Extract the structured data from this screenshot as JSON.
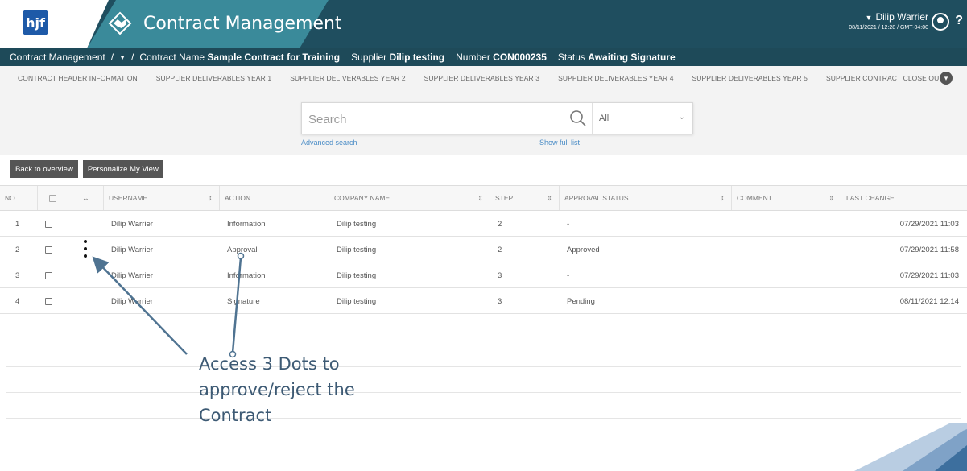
{
  "header": {
    "logo_text": "hjf",
    "app_title": "Contract Management",
    "user_name": "Dilip Warrier",
    "user_caret": "▼",
    "timestamp": "08/11/2021 / 12:28 / GMT-04:00",
    "help_label": "?"
  },
  "breadcrumb": {
    "root": "Contract Management",
    "separator": "/",
    "dropdown_icon": "▼",
    "contract_name_label": "Contract Name",
    "contract_name_value": "Sample Contract for Training",
    "supplier_label": "Supplier",
    "supplier_value": "Dilip testing",
    "number_label": "Number",
    "number_value": "CON000235",
    "status_label": "Status",
    "status_value": "Awaiting Signature"
  },
  "tabs": [
    "CONTRACT HEADER INFORMATION",
    "SUPPLIER DELIVERABLES YEAR 1",
    "SUPPLIER DELIVERABLES YEAR 2",
    "SUPPLIER DELIVERABLES YEAR 3",
    "SUPPLIER DELIVERABLES YEAR 4",
    "SUPPLIER DELIVERABLES YEAR 5",
    "SUPPLIER CONTRACT CLOSE OUT"
  ],
  "search": {
    "placeholder": "Search",
    "scope_value": "All",
    "advanced_link": "Advanced search",
    "full_list_link": "Show full list"
  },
  "buttons": {
    "back": "Back to overview",
    "personalize": "Personalize My View"
  },
  "table": {
    "columns": {
      "no": "NO.",
      "username": "USERNAME",
      "action": "ACTION",
      "company": "COMPANY NAME",
      "step": "STEP",
      "approval": "APPROVAL STATUS",
      "comment": "COMMENT",
      "last_change": "LAST CHANGE"
    },
    "rows": [
      {
        "no": "1",
        "username": "Dilip Warrier",
        "action": "Information",
        "company": "Dilip testing",
        "step": "2",
        "approval": "-",
        "comment": "",
        "last_change": "07/29/2021 11:03"
      },
      {
        "no": "2",
        "username": "Dilip Warrier",
        "action": "Approval",
        "company": "Dilip testing",
        "step": "2",
        "approval": "Approved",
        "comment": "",
        "last_change": "07/29/2021 11:58"
      },
      {
        "no": "3",
        "username": "Dilip Warrier",
        "action": "Information",
        "company": "Dilip testing",
        "step": "3",
        "approval": "-",
        "comment": "",
        "last_change": "07/29/2021 11:03"
      },
      {
        "no": "4",
        "username": "Dilip Warrier",
        "action": "Signature",
        "company": "Dilip testing",
        "step": "3",
        "approval": "Pending",
        "comment": "",
        "last_change": "08/11/2021 12:14"
      }
    ]
  },
  "annotation": {
    "line1": "Access 3 Dots to",
    "line2": "approve/reject the",
    "line3": "Contract"
  },
  "colors": {
    "header_bg": "#1f4e5f",
    "header_accent": "#3a8a9a",
    "link": "#4a8cc6",
    "button_bg": "#555555",
    "arrow": "#4f7391"
  }
}
